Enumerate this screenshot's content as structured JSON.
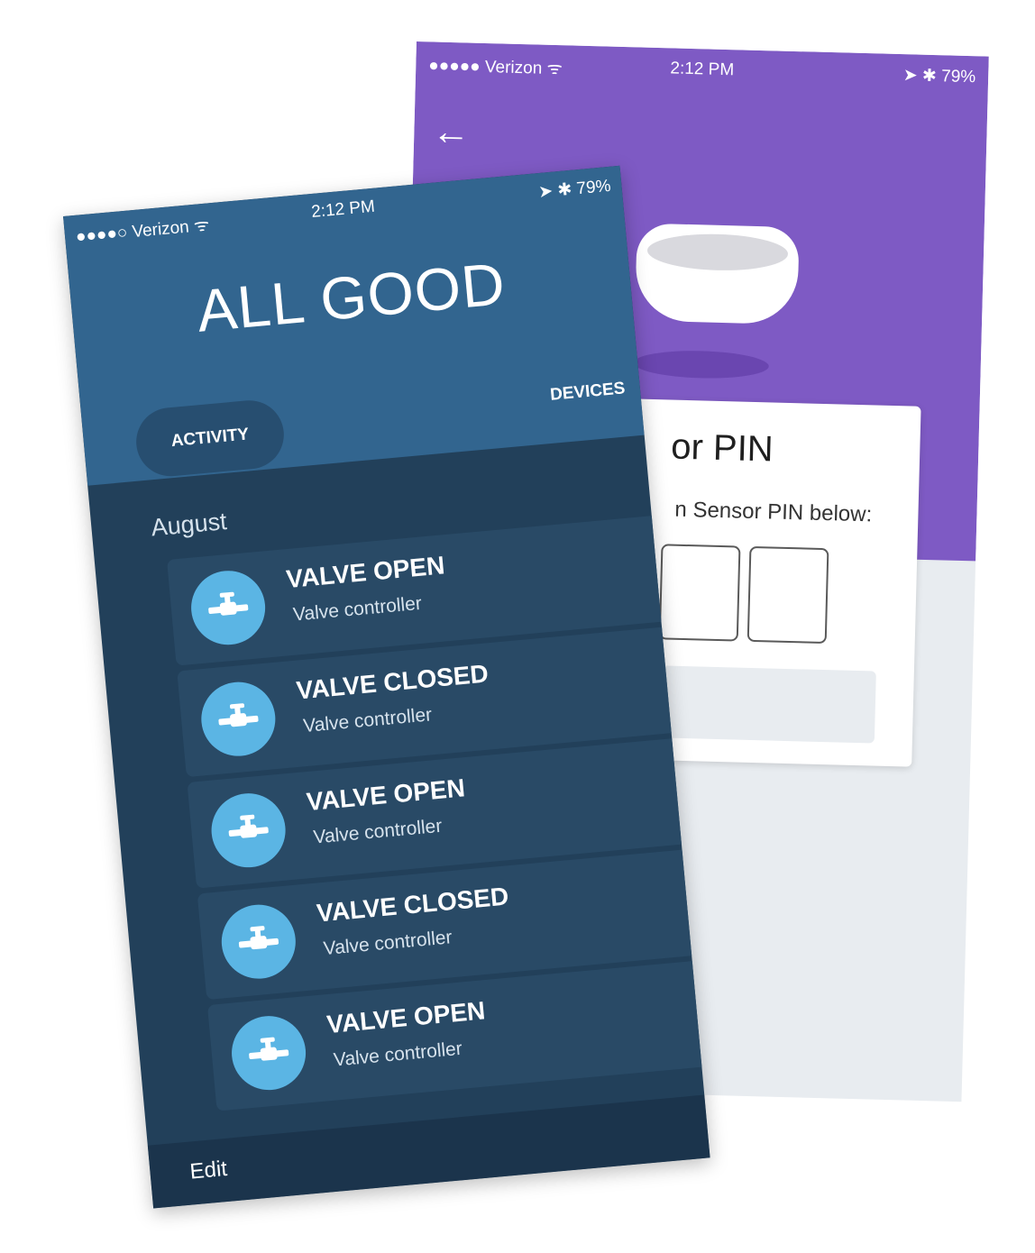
{
  "back_screen": {
    "status": {
      "carrier": "●●●●● Verizon ᯤ",
      "time": "2:12 PM",
      "right": "➤ ✱ 79%"
    },
    "back_icon": "←",
    "pin_title": "or PIN",
    "pin_instruction": "n Sensor PIN below:",
    "colors": {
      "header": "#7e5ac4",
      "body": "#e8ecf0"
    }
  },
  "front_screen": {
    "status": {
      "carrier": "●●●●○ Verizon ᯤ",
      "time": "2:12 PM",
      "right": "➤ ✱ 79%"
    },
    "title": "ALL GOOD",
    "tabs": {
      "activity": "ACTIVITY",
      "devices": "DEVICES"
    },
    "section": "August",
    "items": [
      {
        "title": "VALVE OPEN",
        "subtitle": "Valve controller",
        "icon": "valve-icon"
      },
      {
        "title": "VALVE CLOSED",
        "subtitle": "Valve controller",
        "icon": "valve-icon"
      },
      {
        "title": "VALVE OPEN",
        "subtitle": "Valve controller",
        "icon": "valve-icon"
      },
      {
        "title": "VALVE CLOSED",
        "subtitle": "Valve controller",
        "icon": "valve-icon"
      },
      {
        "title": "VALVE OPEN",
        "subtitle": "Valve controller",
        "icon": "valve-icon"
      }
    ],
    "footer": {
      "edit": "Edit"
    },
    "colors": {
      "header": "#32658f",
      "list_bg": "#22405a",
      "icon_bg": "#5bb5e4"
    }
  }
}
